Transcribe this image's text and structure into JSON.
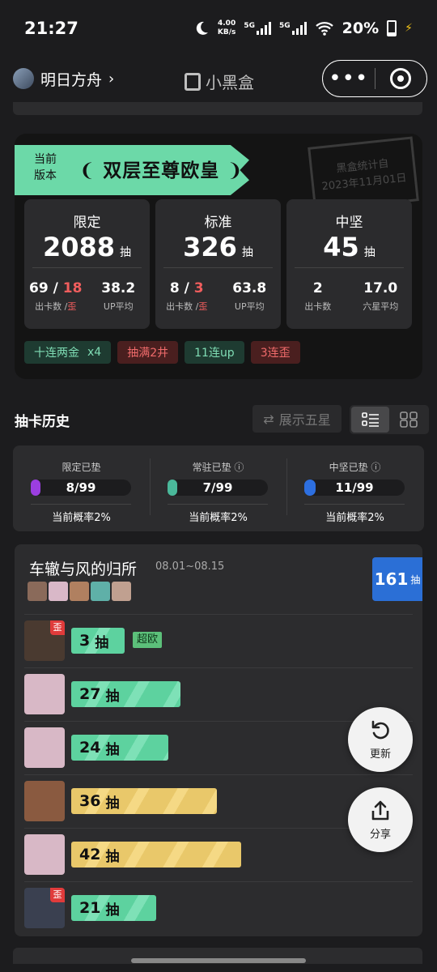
{
  "status": {
    "time": "21:27",
    "speed": "4.00",
    "speed_unit": "KB/s",
    "net1": "5G",
    "net2": "5G",
    "battery": "20%"
  },
  "nav": {
    "app_name": "明日方舟",
    "chevron": "›",
    "brand": "小黑盒",
    "more_icon": "•••"
  },
  "summary": {
    "badge_line1": "当前",
    "badge_line2": "版本",
    "title": "双层至尊欧皇",
    "stamp_line1": "黑盒统计自",
    "stamp_line2": "2023年11月01日",
    "boxes": [
      {
        "label": "限定",
        "total": "2088",
        "unit": "抽",
        "v1a": "69",
        "sep": " / ",
        "v1b": "18",
        "cap1a": "出卡数 /",
        "cap1b": "歪",
        "v2": "38.2",
        "cap2": "UP平均"
      },
      {
        "label": "标准",
        "total": "326",
        "unit": "抽",
        "v1a": "8",
        "sep": " / ",
        "v1b": "3",
        "cap1a": "出卡数 /",
        "cap1b": "歪",
        "v2": "63.8",
        "cap2": "UP平均"
      },
      {
        "label": "中坚",
        "total": "45",
        "unit": "抽",
        "v1a": "2",
        "cap1a": "出卡数",
        "v2": "17.0",
        "cap2": "六星平均"
      }
    ],
    "tags": [
      {
        "text": "十连两金",
        "count": "x4",
        "color": "green"
      },
      {
        "text": "抽满2井",
        "color": "red"
      },
      {
        "text": "11连up",
        "color": "green"
      },
      {
        "text": "3连歪",
        "color": "red"
      }
    ]
  },
  "history": {
    "title": "抽卡历史",
    "toggle_label": "展示五星",
    "toggle_icon": "⇄"
  },
  "pity": [
    {
      "label": "限定已垫",
      "value": "8/99",
      "fraction": 0.0808,
      "color": "#9b3ee0",
      "prob": "当前概率2%"
    },
    {
      "label": "常驻已垫",
      "info": "ⓘ",
      "value": "7/99",
      "fraction": 0.0707,
      "color": "#4ab89a",
      "prob": "当前概率2%"
    },
    {
      "label": "中坚已垫",
      "info": "ⓘ",
      "value": "11/99",
      "fraction": 0.1111,
      "color": "#2d6fe0",
      "prob": "当前概率2%"
    }
  ],
  "banner": {
    "title": "车辙与风的归所",
    "date": "08.01~08.15",
    "count": "161",
    "count_unit": "抽",
    "mini_colors": [
      "#8a6a5a",
      "#d9b8c8",
      "#b08060",
      "#5fb0a8",
      "#c0a090"
    ],
    "rows": [
      {
        "pulls": "3",
        "unit": "抽",
        "tag": "歪",
        "badge": "超欧",
        "color": "green",
        "fraction": 0.038,
        "av_color": "#4a3a30"
      },
      {
        "pulls": "27",
        "unit": "抽",
        "color": "green",
        "fraction": 0.338,
        "av_color": "#d8b8c6"
      },
      {
        "pulls": "24",
        "unit": "抽",
        "color": "green",
        "fraction": 0.3,
        "av_color": "#d8b8c6"
      },
      {
        "pulls": "36",
        "unit": "抽",
        "color": "gold",
        "fraction": 0.45,
        "av_color": "#8a5a40"
      },
      {
        "pulls": "42",
        "unit": "抽",
        "color": "gold",
        "fraction": 0.525,
        "av_color": "#d8b8c6"
      },
      {
        "pulls": "21",
        "unit": "抽",
        "tag": "歪",
        "color": "green",
        "fraction": 0.263,
        "av_color": "#3a4050"
      }
    ]
  },
  "fab": {
    "refresh": "更新",
    "share": "分享"
  }
}
